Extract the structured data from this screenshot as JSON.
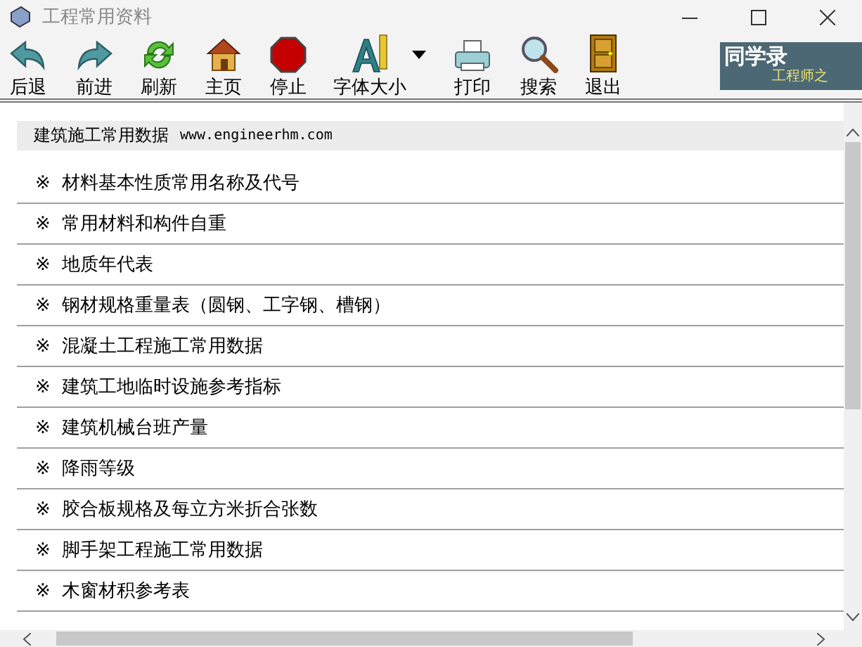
{
  "window": {
    "title": "工程常用资料"
  },
  "toolbar": [
    {
      "kind": "back",
      "label": "后退"
    },
    {
      "kind": "forward",
      "label": "前进"
    },
    {
      "kind": "refresh",
      "label": "刷新"
    },
    {
      "kind": "home",
      "label": "主页"
    },
    {
      "kind": "stop",
      "label": "停止"
    },
    {
      "kind": "font",
      "label": "字体大小",
      "has_menu": true
    },
    {
      "kind": "print",
      "label": "打印"
    },
    {
      "kind": "search",
      "label": "搜索"
    },
    {
      "kind": "exit",
      "label": "退出"
    }
  ],
  "logo": {
    "title": "同学录",
    "subtitle": "工程师之"
  },
  "content": {
    "heading": "建筑施工常用数据",
    "site": "www.engineerhm.com",
    "items": [
      {
        "mark": "※",
        "text": "材料基本性质常用名称及代号"
      },
      {
        "mark": "※",
        "text": "常用材料和构件自重"
      },
      {
        "mark": "※",
        "text": "地质年代表"
      },
      {
        "mark": "※",
        "text": "钢材规格重量表（圆钢、工字钢、槽钢）"
      },
      {
        "mark": "※",
        "text": "混凝土工程施工常用数据"
      },
      {
        "mark": "※",
        "text": "建筑工地临时设施参考指标"
      },
      {
        "mark": "※",
        "text": "建筑机械台班产量"
      },
      {
        "mark": "※",
        "text": "降雨等级"
      },
      {
        "mark": "※",
        "text": "胶合板规格及每立方米折合张数"
      },
      {
        "mark": "※",
        "text": "脚手架工程施工常用数据"
      },
      {
        "mark": "※",
        "text": "木窗材积参考表"
      }
    ]
  }
}
